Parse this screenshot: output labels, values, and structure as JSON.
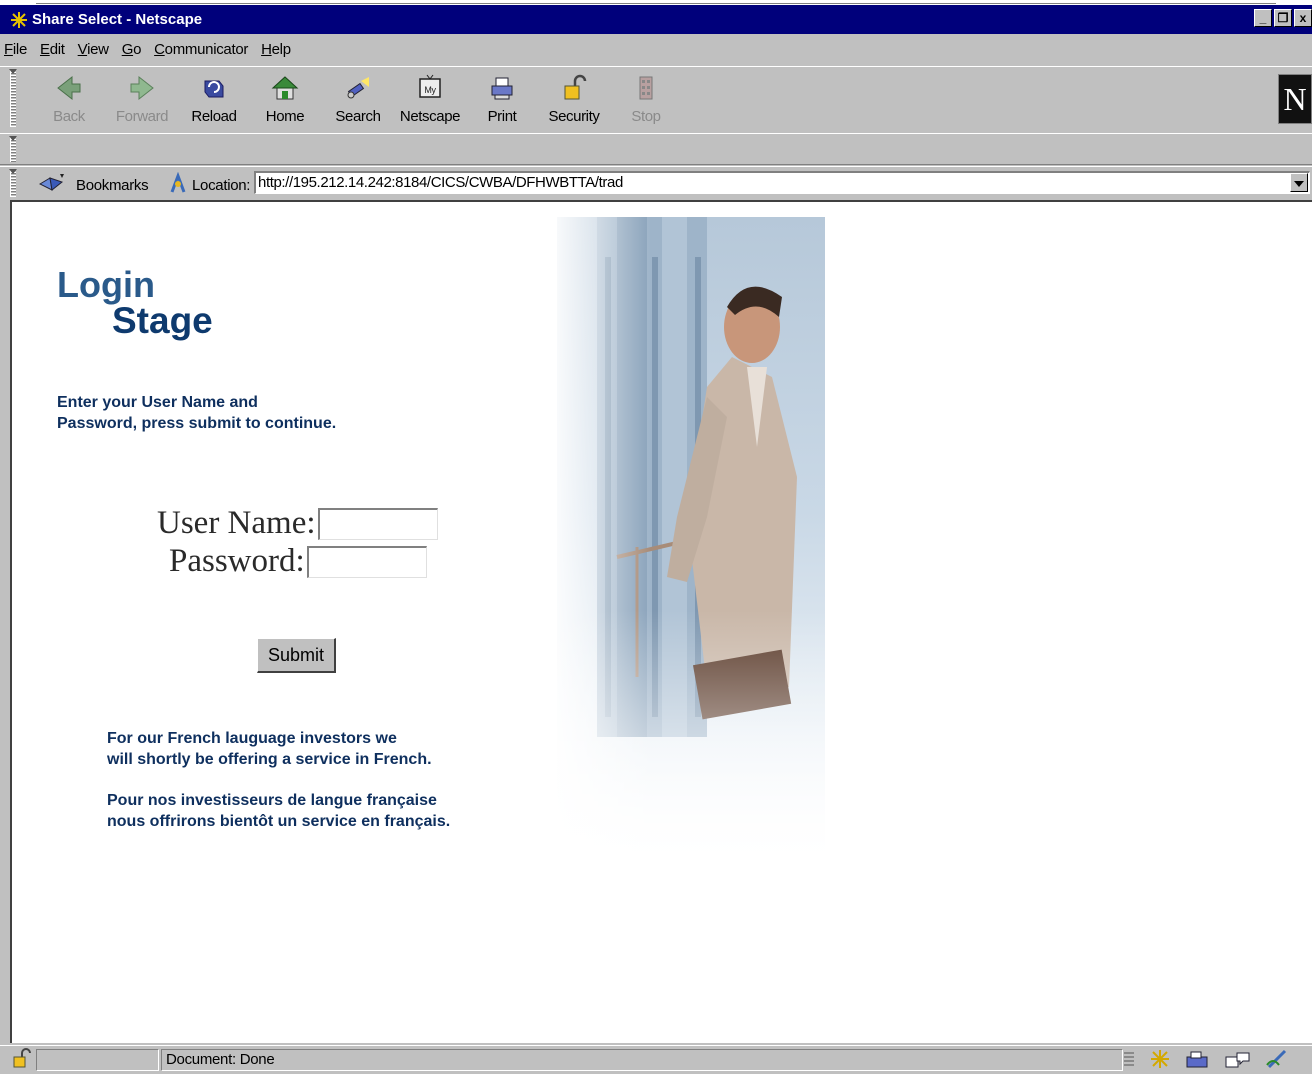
{
  "window": {
    "title": "Share Select - Netscape",
    "controls": [
      "_",
      "❐",
      "x"
    ]
  },
  "menu": [
    {
      "u": "F",
      "rest": "ile"
    },
    {
      "u": "E",
      "rest": "dit"
    },
    {
      "u": "V",
      "rest": "iew"
    },
    {
      "u": "G",
      "rest": "o"
    },
    {
      "u": "C",
      "rest": "ommunicator"
    },
    {
      "u": "H",
      "rest": "elp"
    }
  ],
  "toolbar": {
    "back": "Back",
    "forward": "Forward",
    "reload": "Reload",
    "home": "Home",
    "search": "Search",
    "netscape": "Netscape",
    "print": "Print",
    "security": "Security",
    "stop": "Stop",
    "logo": "N"
  },
  "location": {
    "bookmarks": "Bookmarks",
    "label": "Location:",
    "url": "http://195.212.14.242:8184/CICS/CWBA/DFHWBTTA/trad"
  },
  "page": {
    "heading_login": "Login",
    "heading_stage": "Stage",
    "intro_line1": "Enter your User Name and",
    "intro_line2": "Password, press submit to continue.",
    "username_label": "User Name:",
    "password_label": "Password:",
    "submit_label": "Submit",
    "note_en_line1": "For our French lauguage investors we",
    "note_en_line2": "will shortly be offering a service in French.",
    "note_fr_line1": "Pour nos investisseurs de langue française",
    "note_fr_line2": "nous offrirons bientôt un service en français."
  },
  "status": {
    "text": "Document: Done"
  },
  "colors": {
    "titlebar": "#00007b",
    "chrome": "#c0c0c0",
    "heading_login": "#2a5a8a",
    "heading_stage": "#0e3a6e",
    "body_text": "#0e2f5e"
  }
}
